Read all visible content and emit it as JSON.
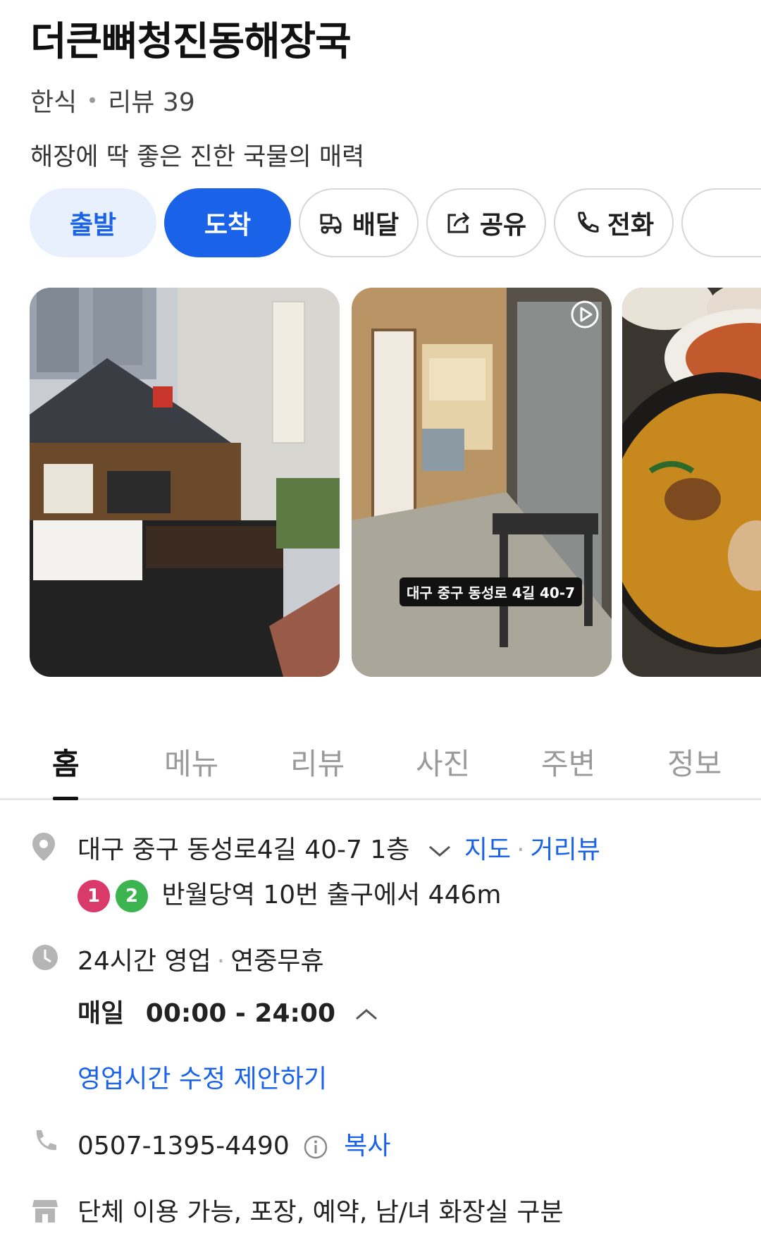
{
  "place": {
    "name": "더큰뼈청진동해장국",
    "category": "한식",
    "review_label": "리뷰 39",
    "description": "해장에 딱 좋은 진한 국물의 매력"
  },
  "actions": {
    "start": "출발",
    "arrive": "도착",
    "delivery": "배달",
    "share": "공유",
    "call": "전화"
  },
  "photos": {
    "caption": "대구 중구 동성로 4길 40-7",
    "icons": [
      "storefront-photo",
      "video-play-icon",
      "soup-photo"
    ]
  },
  "tabs": [
    "홈",
    "메뉴",
    "리뷰",
    "사진",
    "주변",
    "정보"
  ],
  "active_tab": "홈",
  "info": {
    "address": "대구 중구 동성로4길 40-7 1층",
    "map_link": "지도",
    "street_view_link": "거리뷰",
    "subway_line1": "1",
    "subway_line2": "2",
    "subway_directions": "반월당역 10번 출구에서 446m",
    "hours_status": "24시간 영업",
    "holiday": "연중무휴",
    "hours_day": "매일",
    "hours_time": "00:00 - 24:00",
    "suggest_hours": "영업시간 수정 제안하기",
    "phone": "0507-1395-4490",
    "copy": "복사",
    "amenities": "단체 이용 가능, 포장, 예약, 남/녀 화장실 구분"
  },
  "colors": {
    "accent": "#1a63e8",
    "accent_light": "#e8f0fe",
    "line1": "#d93a6a",
    "line2": "#3cb551"
  }
}
